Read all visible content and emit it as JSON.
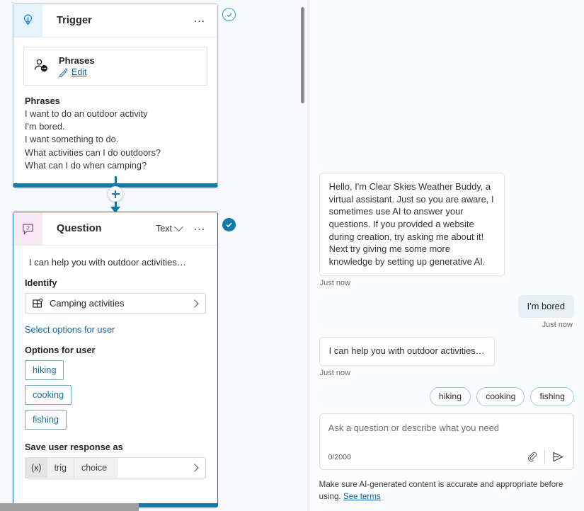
{
  "canvas": {
    "trigger_node": {
      "title": "Trigger",
      "icon": "trigger-lightning-pin-icon",
      "menu": "…",
      "status": "valid-check",
      "sub_card": {
        "title": "Phrases",
        "icon": "person-chat-icon",
        "edit_label": "Edit",
        "edit_icon": "pencil-icon"
      },
      "phrases_heading": "Phrases",
      "phrases": [
        "I want to do an outdoor activity",
        "I'm bored.",
        "I want something to do.",
        "What activities can I do outdoors?",
        "What can I do when camping?"
      ]
    },
    "connector": {
      "add_label": "+"
    },
    "question_node": {
      "title": "Question",
      "icon": "question-bubble-icon",
      "type_label": "Text",
      "menu": "…",
      "status": "valid-check-filled",
      "prompt": "I can help you with outdoor activities…",
      "identify_label": "Identify",
      "identify_value": "Camping activities",
      "identify_icon": "entity-grid-icon",
      "select_options_link": "Select options for user",
      "options_label": "Options for user",
      "options": [
        "hiking",
        "cooking",
        "fishing"
      ],
      "save_label": "Save user response as",
      "variable": {
        "type_token": "(x)",
        "scope": "trig",
        "name": "choice"
      }
    }
  },
  "chat": {
    "messages": [
      {
        "role": "bot",
        "text": "Hello, I'm Clear Skies Weather Buddy, a virtual assistant. Just so you are aware, I sometimes use AI to answer your questions. If you provided a website during creation, try asking me about it! Next try giving me some more knowledge by setting up generative AI.",
        "timestamp": "Just now"
      },
      {
        "role": "user",
        "text": "I'm bored",
        "timestamp": "Just now"
      },
      {
        "role": "bot",
        "text": "I can help you with outdoor activities…",
        "timestamp": "Just now"
      }
    ],
    "quick_replies": [
      "hiking",
      "cooking",
      "fishing"
    ],
    "composer": {
      "placeholder": "Ask a question or describe what you need",
      "counter": "0/2000",
      "attach_icon": "paperclip-icon",
      "send_icon": "send-icon"
    },
    "disclaimer_text": "Make sure AI-generated content is accurate and appropriate before using.",
    "disclaimer_link": "See terms"
  },
  "colors": {
    "accent": "#1279a8",
    "link": "#1264a3",
    "trigger_icon_bg": "#e7f3fb",
    "question_icon_bg": "#f6e9f4",
    "canvas_bg": "#f8f9fd"
  }
}
